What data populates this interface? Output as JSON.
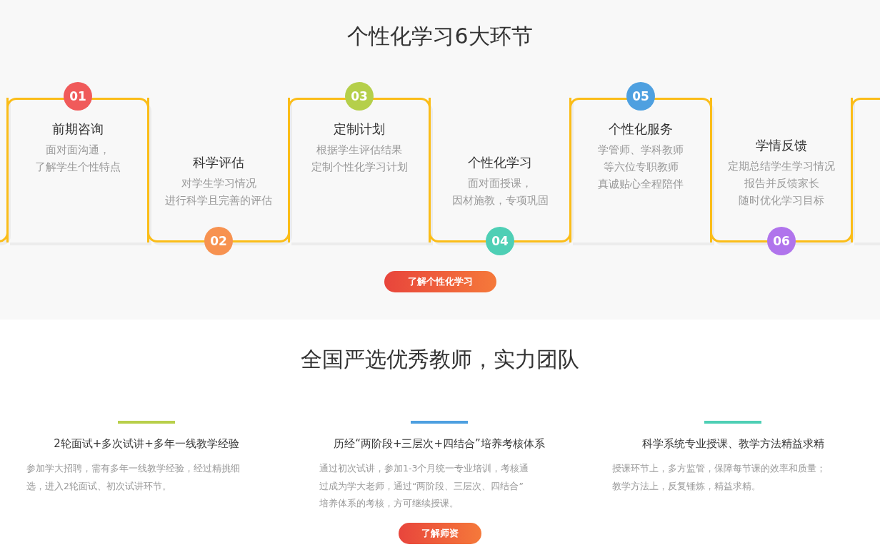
{
  "steps_section": {
    "title": "个性化学习6大环节",
    "steps": [
      {
        "number": "01",
        "kind": "top",
        "color": "#f05a5a",
        "title": "前期咨询",
        "lines": [
          "面对面沟通，",
          "了解学生个性特点"
        ]
      },
      {
        "number": "02",
        "kind": "bottom",
        "color": "#f79250",
        "title": "科学评估",
        "lines": [
          "对学生学习情况",
          "进行科学且完善的评估"
        ]
      },
      {
        "number": "03",
        "kind": "top",
        "color": "#b5cf4a",
        "title": "定制计划",
        "lines": [
          "根据学生评估结果",
          "定制个性化学习计划"
        ]
      },
      {
        "number": "04",
        "kind": "bottom",
        "color": "#4ecfb5",
        "title": "个性化学习",
        "lines": [
          "面对面授课，",
          "因材施教，专项巩固"
        ]
      },
      {
        "number": "05",
        "kind": "top",
        "color": "#4ea0e0",
        "title": "个性化服务",
        "lines": [
          "学管师、学科教师",
          "等六位专职教师",
          "真诚贴心全程陪伴"
        ]
      },
      {
        "number": "06",
        "kind": "bottom",
        "color": "#b074ec",
        "title": "学情反馈",
        "lines": [
          "定期总结学生学习情况",
          "报告并反馈家长",
          "随时优化学习目标"
        ]
      }
    ],
    "button": "了解个性化学习"
  },
  "teachers_section": {
    "title": "全国严选优秀教师，实力团队",
    "features": [
      {
        "color": "#b8cf4a",
        "title": "2轮面试+多次试讲+多年一线教学经验",
        "lines": [
          "参加学大招聘，需有多年一线教学经验，经过精挑细",
          "选，进入2轮面试、初次试讲环节。"
        ]
      },
      {
        "color": "#4d9fe0",
        "title": "历经“两阶段+三层次+四结合”培养考核体系",
        "lines": [
          "通过初次试讲，参加1-3个月统一专业培训，考核通",
          "过成为学大老师，通过“两阶段、三层次、四结合”",
          "培养体系的考核，方可继续授课。"
        ]
      },
      {
        "color": "#4ecfb5",
        "title": "科学系统专业授课、教学方法精益求精",
        "lines": [
          "授课环节上，多方监管，保障每节课的效率和质量；",
          "教学方法上，反复锤炼，精益求精。"
        ]
      }
    ],
    "button": "了解师资"
  }
}
